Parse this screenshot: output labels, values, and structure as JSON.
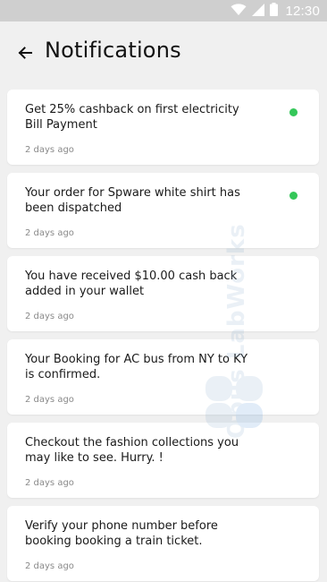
{
  "status_bar": {
    "time": "12:30",
    "icons": [
      "wifi-icon",
      "cellular-signal-icon",
      "battery-icon"
    ]
  },
  "header": {
    "title": "Notifications",
    "back_icon": "back-arrow-icon"
  },
  "notifications": [
    {
      "message": "Get 25% cashback on first electricity Bill Payment",
      "time": "2 days ago",
      "unread": true
    },
    {
      "message": "Your order for Spware white shirt has been dispatched",
      "time": "2 days ago",
      "unread": true
    },
    {
      "message": "You have received $10.00 cash back added in your wallet",
      "time": "2 days ago",
      "unread": false
    },
    {
      "message": "Your Booking for AC bus from NY to KY is confirmed.",
      "time": "2 days ago",
      "unread": false
    },
    {
      "message": "Checkout the fashion collections you may like to see. Hurry. !",
      "time": "2 days ago",
      "unread": false
    },
    {
      "message": "Verify your phone number before booking booking a train ticket.",
      "time": "2 days ago",
      "unread": false
    }
  ],
  "watermark": {
    "text": "Opus LabWorks"
  },
  "colors": {
    "unread_dot": "#34c759",
    "background": "#f0f0f0",
    "status_bar": "#cfcfcf"
  }
}
